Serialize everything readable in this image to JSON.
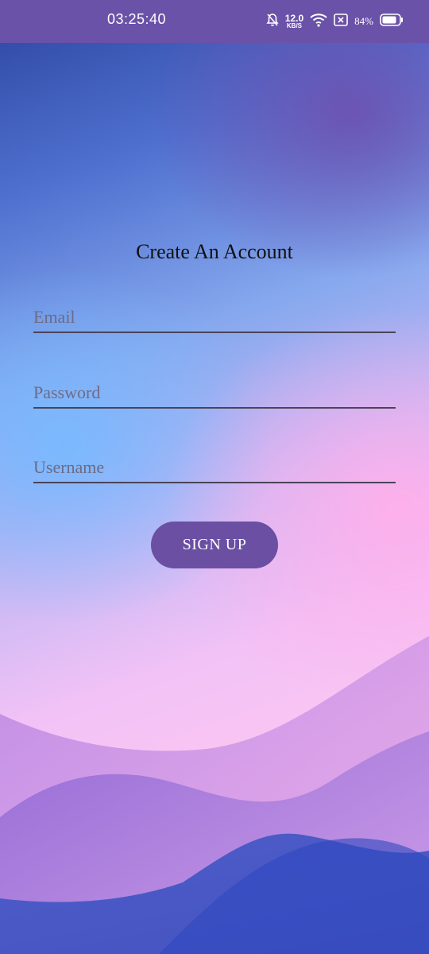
{
  "status_bar": {
    "time": "03:25:40",
    "net_speed_value": "12.0",
    "net_speed_unit": "KB/S",
    "battery_percent": "84%",
    "icons": [
      "bell-off-icon",
      "wifi-icon",
      "sim-x-icon",
      "battery-icon"
    ],
    "background_color": "#6a52a8"
  },
  "form": {
    "title": "Create An Account",
    "email_placeholder": "Email",
    "password_placeholder": "Password",
    "username_placeholder": "Username",
    "email_value": "",
    "password_value": "",
    "username_value": "",
    "signup_label": "SIGN UP",
    "button_color": "#6a4fa3"
  }
}
